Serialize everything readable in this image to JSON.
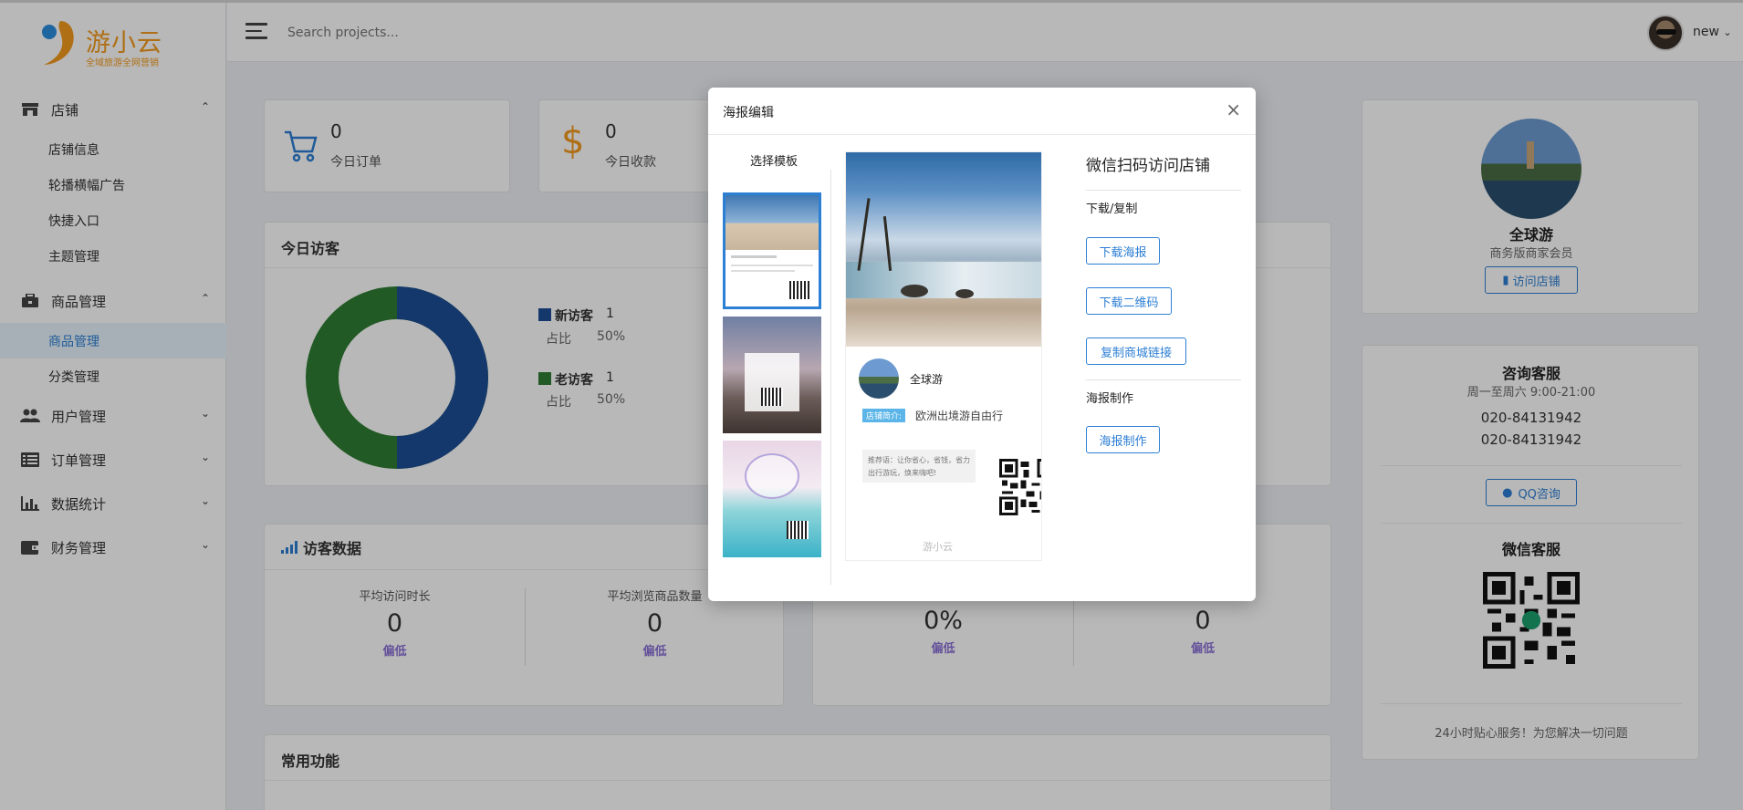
{
  "brand": {
    "name": "游小云",
    "slogan": "全域旅游全网营销",
    "logo_color": "#f39a1e"
  },
  "header": {
    "search_placeholder": "Search projects...",
    "username": "new"
  },
  "sidebar": {
    "groups": [
      {
        "label": "店铺",
        "items": [
          "店铺信息",
          "轮播横幅广告",
          "快捷入口",
          "主题管理"
        ]
      },
      {
        "label": "商品管理",
        "items": [
          "商品管理",
          "分类管理"
        ]
      },
      {
        "label": "用户管理"
      },
      {
        "label": "订单管理"
      },
      {
        "label": "数据统计"
      },
      {
        "label": "财务管理"
      }
    ]
  },
  "stats": {
    "orders": {
      "value": "0",
      "label": "今日订单"
    },
    "revenue": {
      "value": "0",
      "label": "今日收款"
    }
  },
  "visitors_today": {
    "title": "今日访客",
    "new_label": "新访客",
    "new_count": "1",
    "new_ratio_label": "占比",
    "new_ratio": "50%",
    "old_label": "老访客",
    "old_count": "1",
    "old_ratio_label": "占比",
    "old_ratio": "50%",
    "colors": {
      "new": "#1e4e96",
      "old": "#2e7d32"
    }
  },
  "visitor_data": {
    "title": "访客数据",
    "cols": [
      {
        "label": "平均访问时长",
        "value": "0",
        "level": "偏低"
      },
      {
        "label": "平均浏览商品数量",
        "value": "0",
        "level": "偏低"
      },
      {
        "label": "",
        "value": "0%",
        "level": "偏低"
      },
      {
        "label": "",
        "value": "0",
        "level": "偏低"
      }
    ]
  },
  "common": {
    "title": "常用功能"
  },
  "profile": {
    "name": "全球游",
    "level": "商务版商家会员",
    "visit_btn": "访问店铺"
  },
  "support": {
    "title": "咨询客服",
    "hours": "周一至周六 9:00-21:00",
    "phone1": "020-84131942",
    "phone2": "020-84131942",
    "qq_btn": "QQ咨询",
    "wechat_title": "微信客服",
    "footer": "24小时贴心服务！为您解决一切问题"
  },
  "modal": {
    "title": "海报编辑",
    "close": "×",
    "tpl_title": "选择模板",
    "scan_title": "微信扫码访问店铺",
    "section1": "下载/复制",
    "btn_poster": "下载海报",
    "btn_qr": "下载二维码",
    "btn_link": "复制商城链接",
    "section2": "海报制作",
    "btn_make": "海报制作",
    "poster": {
      "shop": "全球游",
      "tag": "店铺简介:",
      "desc": "欧洲出境游自由行",
      "recommend": "推荐语：让你省心，省钱，省力出行游玩，焕来嗨吧!",
      "footer_brand": "游小云"
    }
  }
}
